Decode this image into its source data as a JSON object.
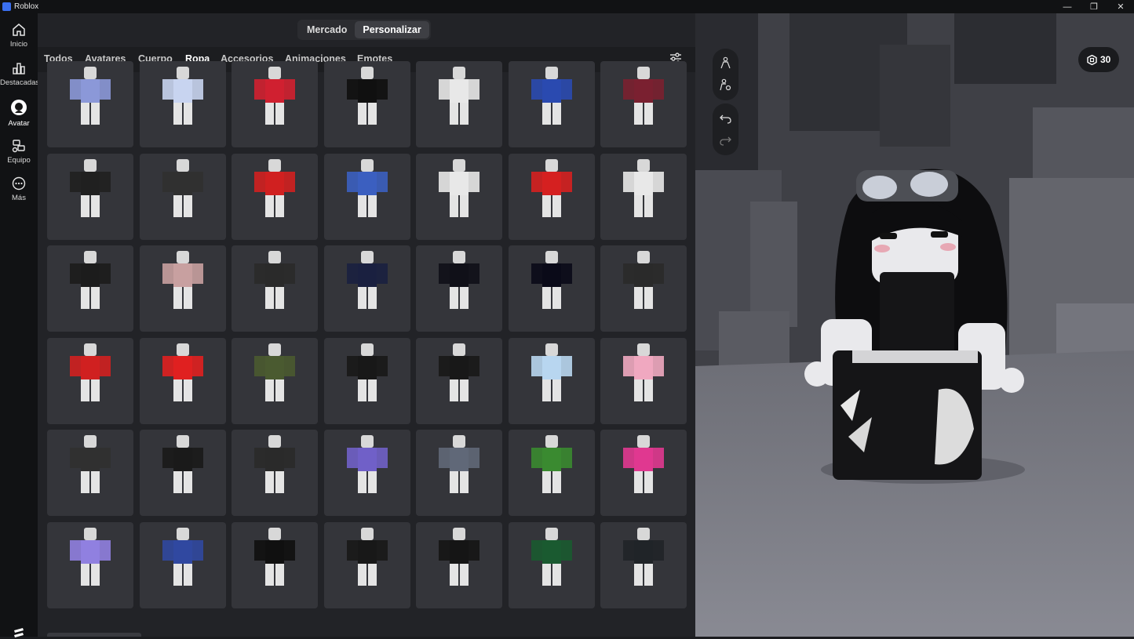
{
  "window": {
    "title": "Roblox",
    "controls": [
      "minimize",
      "maximize",
      "close"
    ]
  },
  "sidebar": {
    "items": [
      {
        "label": "Inicio",
        "icon": "home-icon"
      },
      {
        "label": "Destacadas",
        "icon": "chart-icon"
      },
      {
        "label": "Avatar",
        "icon": "avatar-icon",
        "active": true
      },
      {
        "label": "Equipo",
        "icon": "party-icon"
      },
      {
        "label": "Más",
        "icon": "more-icon"
      }
    ]
  },
  "segment": {
    "options": [
      "Mercado",
      "Personalizar"
    ],
    "selected": "Personalizar"
  },
  "tabs": {
    "items": [
      "Todos",
      "Avatares",
      "Cuerpo",
      "Ropa",
      "Accesorios",
      "Animaciones",
      "Emotes"
    ],
    "selected": "Ropa"
  },
  "robux": {
    "balance": "30"
  },
  "catalog_items": [
    [
      "#8b98d8",
      "#c8d4f0",
      "#d02030",
      "#101010",
      "#e8e8e8",
      "#2a4ab0",
      "#7a2030"
    ],
    [
      "#202020",
      "#303030",
      "#d02020",
      "#3b5fc0",
      "#e8e8e8",
      "#d52020",
      "#e8e8e8"
    ],
    [
      "#1c1c1c",
      "#c8a0a0",
      "#2a2a2a",
      "#1a2040",
      "#101018",
      "#0a0a18",
      "#2a2a2a"
    ],
    [
      "#d02020",
      "#e02020",
      "#4a5a30",
      "#181818",
      "#181818",
      "#b8d6f0",
      "#f0a8c0"
    ],
    [
      "#303030",
      "#1a1a1a",
      "#2a2a2a",
      "#7060c8",
      "#606878",
      "#3a8a30",
      "#e03890"
    ],
    [
      "#9080e0",
      "#3048a0",
      "#101010",
      "#181818",
      "#151515",
      "#1a5a30",
      "#202428"
    ]
  ],
  "accent_colors": {
    "background": "#222327",
    "card": "#34353a",
    "sidebar": "#111214",
    "selected_tab": "#ffffff"
  }
}
